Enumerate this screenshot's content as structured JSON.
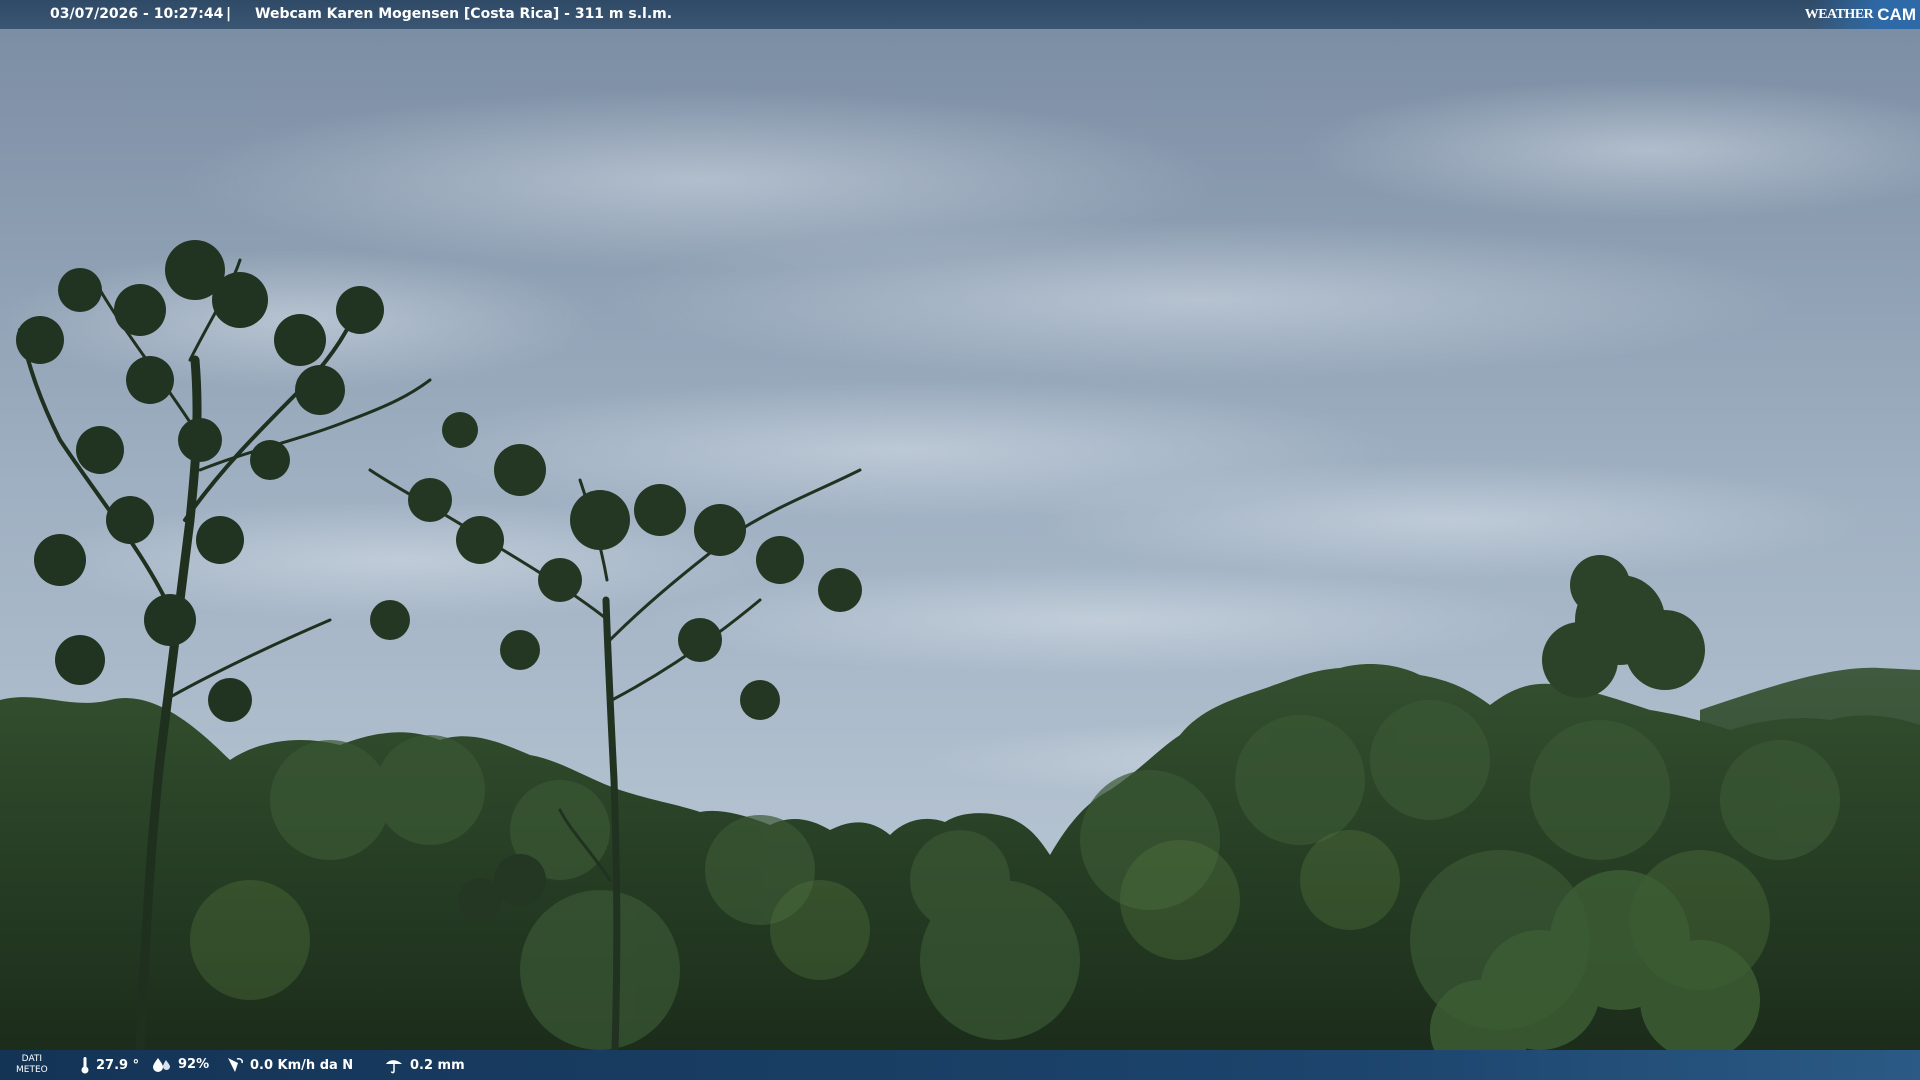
{
  "overlay": {
    "timestamp": "03/07/2026 - 10:27:44",
    "separator": "|",
    "title": "Webcam Karen Mogensen [Costa Rica]  - 311 m s.l.m."
  },
  "brand": {
    "weather": "WEATHER",
    "cam": "CAM"
  },
  "weather": {
    "label_line1": "DATI",
    "label_line2": "METEO",
    "temperature": "27.9 °",
    "humidity": "92%",
    "wind": "0.0 Km/h da N",
    "rain": "0.2 mm"
  },
  "colors": {
    "sky_top": "#7a8ca2",
    "sky_mid": "#9fb0c2",
    "sky_low": "#b8c6d3",
    "foliage_dark": "#1c2e1c",
    "foliage_mid": "#2f4a2c",
    "foliage_light": "#4a6b3e",
    "bar_top": "#2f4a66",
    "bar_bottom": "#143456"
  },
  "icons": [
    "thermometer-icon",
    "humidity-icon",
    "wind-icon",
    "rain-icon"
  ]
}
